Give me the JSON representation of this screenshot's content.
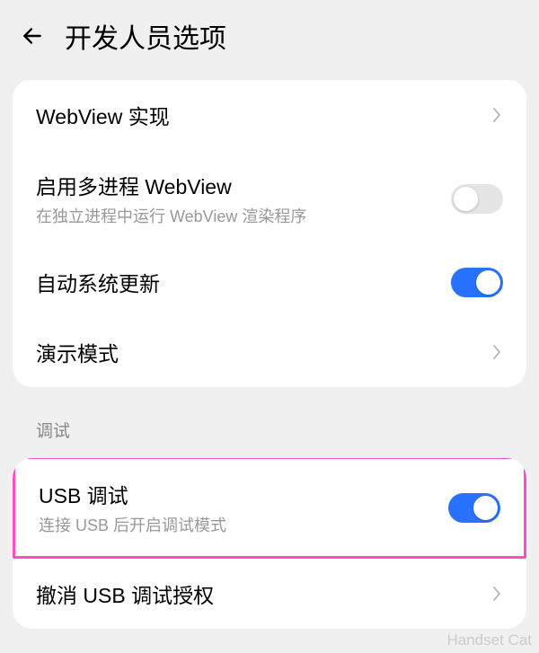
{
  "header": {
    "title": "开发人员选项"
  },
  "card1": {
    "webview_impl": {
      "label": "WebView 实现"
    },
    "multiprocess_webview": {
      "label": "启用多进程 WebView",
      "sublabel": "在独立进程中运行 WebView 渲染程序",
      "enabled": false
    },
    "auto_system_update": {
      "label": "自动系统更新",
      "enabled": true
    },
    "demo_mode": {
      "label": "演示模式"
    }
  },
  "section_debug": {
    "header": "调试"
  },
  "card2": {
    "usb_debugging": {
      "label": "USB 调试",
      "sublabel": "连接 USB 后开启调试模式",
      "enabled": true
    },
    "revoke_usb": {
      "label": "撤消 USB 调试授权"
    }
  },
  "watermark": "Handset Cat"
}
